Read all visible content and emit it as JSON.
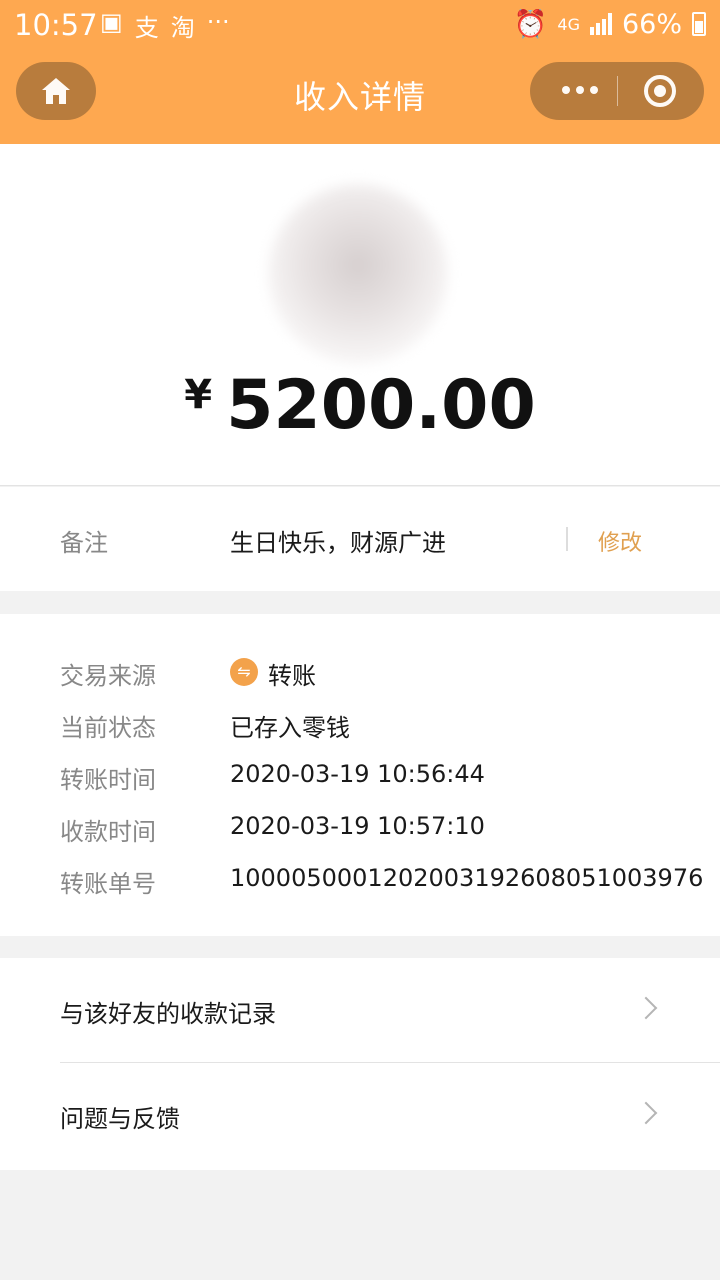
{
  "status_bar": {
    "time": "10:57",
    "left_icons": [
      "image-icon",
      "alipay-icon",
      "taobao-icon",
      "more-dots-icon"
    ],
    "left_glyphs": [
      "▣",
      "支",
      "淘",
      "···"
    ],
    "network": "4G",
    "battery": "66%"
  },
  "nav": {
    "title": "收入详情",
    "accent_color": "#fea850"
  },
  "amount": {
    "currency": "¥",
    "value": "5200.00"
  },
  "remark": {
    "label": "备注",
    "value": "生日快乐，财源广进",
    "edit": "修改"
  },
  "details": [
    {
      "label": "交易来源",
      "value": "转账",
      "icon": "transfer-icon",
      "icon_glyph": "⇋"
    },
    {
      "label": "当前状态",
      "value": "已存入零钱"
    },
    {
      "label": "转账时间",
      "value": "2020-03-19 10:56:44"
    },
    {
      "label": "收款时间",
      "value": "2020-03-19 10:57:10"
    },
    {
      "label": "转账单号",
      "value": "1000050001202003192608051003976"
    }
  ],
  "links": [
    {
      "label": "与该好友的收款记录"
    },
    {
      "label": "问题与反馈"
    }
  ]
}
